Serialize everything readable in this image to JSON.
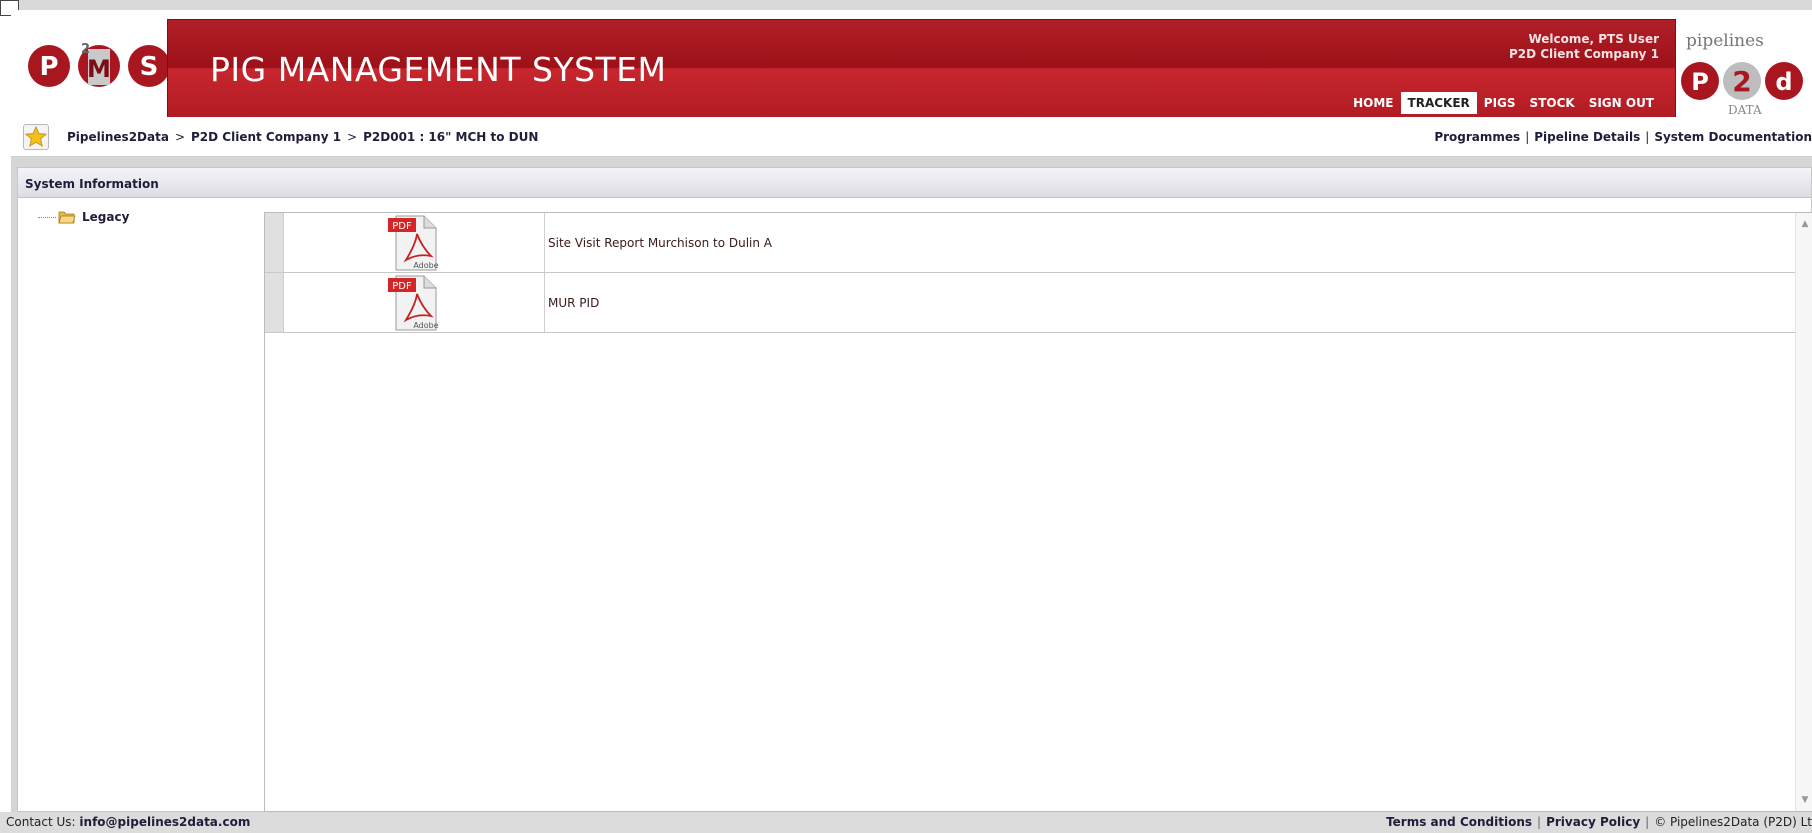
{
  "app": {
    "title": "PIG MANAGEMENT SYSTEM",
    "brand_left": "PMS",
    "brand_right_top": "pipelines",
    "brand_right_bottom": "DATA"
  },
  "user": {
    "welcome": "Welcome, PTS User",
    "company": "P2D Client Company 1"
  },
  "nav": {
    "items": [
      "HOME",
      "TRACKER",
      "PIGS",
      "STOCK",
      "SIGN OUT"
    ],
    "active": "TRACKER"
  },
  "breadcrumb": {
    "items": [
      "Pipelines2Data",
      "P2D Client Company 1",
      "P2D001 : 16\" MCH to DUN"
    ],
    "separator": ">"
  },
  "top_links": {
    "items": [
      "Programmes",
      "Pipeline Details",
      "System Documentation"
    ]
  },
  "section": {
    "title": "System Information"
  },
  "tree": {
    "folder": "Legacy"
  },
  "documents": [
    {
      "type_label": "PDF",
      "vendor": "Adobe",
      "title": "Site Visit Report Murchison to Dulin A"
    },
    {
      "type_label": "PDF",
      "vendor": "Adobe",
      "title": "MUR PID"
    }
  ],
  "footer": {
    "contact_label": "Contact Us:",
    "contact_email": "info@pipelines2data.com",
    "terms": "Terms and Conditions",
    "privacy": "Privacy Policy",
    "copyright": "© Pipelines2Data (P2D) Lt"
  },
  "colors": {
    "banner": "#a8171f",
    "accent_navy": "#1e1e3a",
    "pdf_red": "#d42626"
  }
}
